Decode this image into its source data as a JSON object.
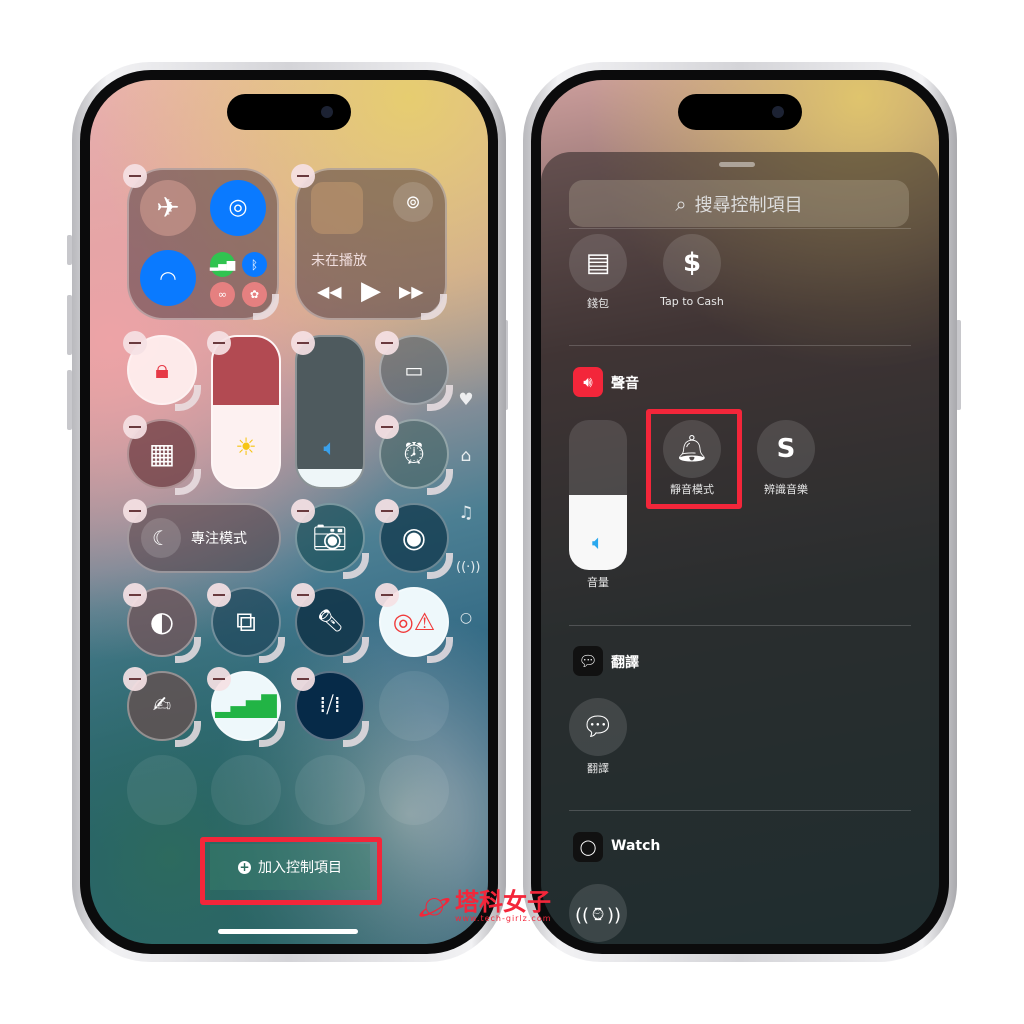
{
  "left_phone": {
    "media": {
      "status": "未在播放",
      "icons": [
        "album-art",
        "airplay-icon",
        "rewind-icon",
        "play-icon",
        "fast-forward-icon"
      ]
    },
    "connectivity": {
      "icons": [
        "airplane-icon",
        "airdrop-icon",
        "wifi-icon",
        "cellular-icon",
        "bluetooth-icon",
        "hotspot-icon",
        "satellite-icon"
      ]
    },
    "focus_label": "專注模式",
    "add_controls_label": "加入控制項目",
    "brightness_level": 0.55,
    "volume_level": 0.12,
    "side_icons": [
      "heart-icon",
      "home-icon",
      "music-icon",
      "antenna-icon",
      "circle-icon"
    ],
    "accent": "#0a7aff"
  },
  "right_phone": {
    "search_placeholder": "搜尋控制項目",
    "wallet": {
      "label": "錢包"
    },
    "tap_to_cash": {
      "label": "Tap to Cash"
    },
    "sound_section": {
      "title": "聲音",
      "volume_label": "音量",
      "silent_label": "靜音模式",
      "shazam_label": "辨識音樂",
      "volume_level": 0.5
    },
    "translate_section": {
      "title": "翻譯",
      "item_label": "翻譯"
    },
    "watch_section": {
      "title": "Watch"
    }
  },
  "highlight_color": "#f3263a",
  "watermark": {
    "text": "塔科女子",
    "url": "www.tech-girlz.com"
  }
}
